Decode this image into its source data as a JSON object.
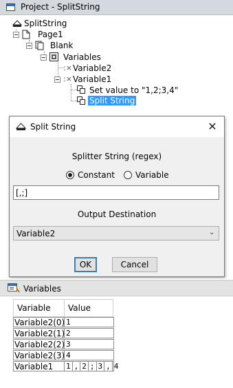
{
  "project": {
    "title": "Project - SplitString",
    "tree": {
      "root": "SplitString",
      "page": "Page1",
      "blank": "Blank",
      "variables": "Variables",
      "variable2": "Variable2",
      "variable1": "Variable1",
      "set_value": "Set value to \"1,2;3,4\"",
      "split_string": "Split String"
    }
  },
  "dialog": {
    "title": "Split String",
    "close_label": "✕",
    "splitter_label": "Splitter String (regex)",
    "radio_constant": "Constant",
    "radio_variable": "Variable",
    "selected_radio": "Constant",
    "regex_value": "[,;]",
    "output_label": "Output Destination",
    "output_value": "Variable2",
    "ok_label": "OK",
    "cancel_label": "Cancel"
  },
  "variables_panel": {
    "title": "Variables",
    "columns": [
      "Variable",
      "Value"
    ],
    "rows": [
      {
        "name": "Variable2(0)",
        "value": [
          "1"
        ]
      },
      {
        "name": "Variable2(1)",
        "value": [
          "2"
        ]
      },
      {
        "name": "Variable2(2)",
        "value": [
          "3"
        ]
      },
      {
        "name": "Variable2(3)",
        "value": [
          "4"
        ]
      },
      {
        "name": "Variable1",
        "value": [
          "1",
          ",",
          "2",
          ";",
          "3",
          ",",
          "4"
        ]
      }
    ]
  }
}
